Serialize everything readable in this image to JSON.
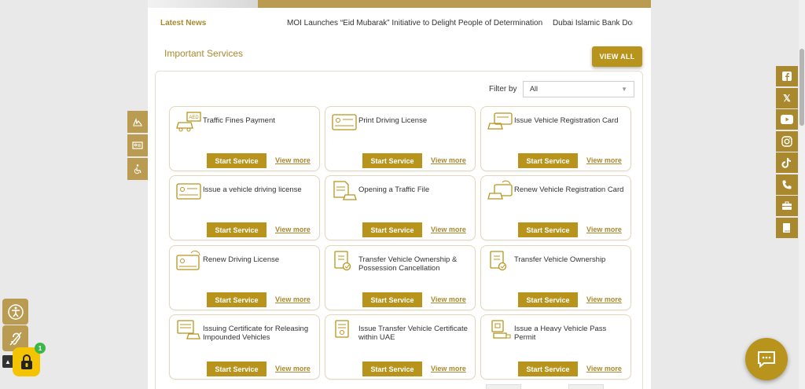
{
  "news": {
    "label": "Latest News",
    "items": [
      "MOI Launches “Eid Mubarak” Initiative to Delight People of Determination",
      "Dubai Islamic Bank Donat"
    ]
  },
  "services": {
    "title": "Important Services",
    "view_all": "VIEW ALL",
    "filter_label": "Filter by",
    "filter_value": "All",
    "start_label": "Start Service",
    "view_more_label": "View more",
    "cards": [
      {
        "title": "Traffic Fines Payment",
        "icon": "car-fine-icon"
      },
      {
        "title": "Print Driving License",
        "icon": "license-card-icon"
      },
      {
        "title": "Issue Vehicle Registration Card",
        "icon": "car-card-icon"
      },
      {
        "title": "Issue a vehicle driving license",
        "icon": "license-card-icon"
      },
      {
        "title": "Opening a Traffic File",
        "icon": "traffic-file-icon"
      },
      {
        "title": "Renew Vehicle Registration Card",
        "icon": "renew-car-card-icon"
      },
      {
        "title": "Renew Driving License",
        "icon": "renew-license-icon"
      },
      {
        "title": "Transfer Vehicle Ownership & Possession Cancellation",
        "icon": "transfer-doc-icon"
      },
      {
        "title": "Transfer Vehicle Ownership",
        "icon": "transfer-doc-icon"
      },
      {
        "title": "Issuing Certificate for Releasing Impounded Vehicles",
        "icon": "certificate-car-icon"
      },
      {
        "title": "Issue Transfer Vehicle Certificate within UAE",
        "icon": "certificate-icon"
      },
      {
        "title": "Issue a Heavy Vehicle Pass Permit",
        "icon": "truck-permit-icon"
      }
    ]
  },
  "notification_badge": "1",
  "colors": {
    "gold": "#b8941d",
    "gold_light": "#b99b52",
    "text_gold": "#a9882e",
    "lock_yellow": "#f5c400"
  }
}
